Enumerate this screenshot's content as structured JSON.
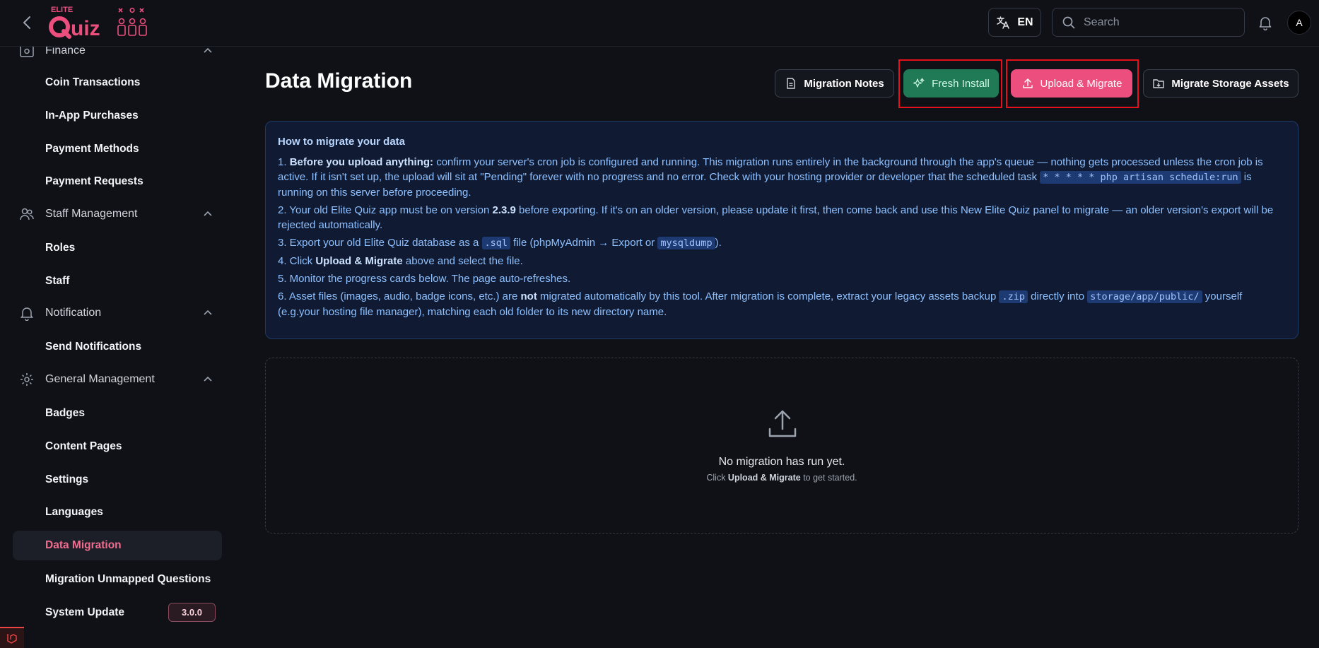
{
  "brand": {
    "logo_top": "ELITE",
    "logo_main": "Quiz",
    "accent": "#ec4f7d"
  },
  "topbar": {
    "language": "EN",
    "search_placeholder": "Search",
    "avatar_initial": "A"
  },
  "sidebar": {
    "groups": {
      "finance": "Finance",
      "staff": "Staff Management",
      "notification": "Notification",
      "general": "General Management"
    },
    "items": {
      "coin_transactions": "Coin Transactions",
      "in_app_purchases": "In-App Purchases",
      "payment_methods": "Payment Methods",
      "payment_requests": "Payment Requests",
      "roles": "Roles",
      "staff": "Staff",
      "send_notifications": "Send Notifications",
      "badges": "Badges",
      "content_pages": "Content Pages",
      "settings": "Settings",
      "languages": "Languages",
      "data_migration": "Data Migration",
      "migration_unmapped": "Migration Unmapped Questions",
      "system_update": "System Update"
    },
    "version_badge": "3.0.0"
  },
  "page": {
    "title": "Data Migration",
    "buttons": {
      "notes": "Migration Notes",
      "fresh": "Fresh Install",
      "upload": "Upload & Migrate",
      "storage": "Migrate Storage Assets"
    }
  },
  "info": {
    "heading": "How to migrate your data",
    "s1_num": "1.",
    "s1_bold": "Before you upload anything:",
    "s1_text": " confirm your server's cron job is configured and running. This migration runs entirely in the background through the app's queue — nothing gets processed unless the cron job is active. If it isn't set up, the upload will sit at \"Pending\" forever with no progress and no error. Check with your hosting provider or developer that the scheduled task ",
    "s1_code": "* * * * * php artisan schedule:run",
    "s1_tail": " is running on this server before proceeding.",
    "s2_a": "2. Your old Elite Quiz app must be on version ",
    "s2_bold": "2.3.9",
    "s2_b": " before exporting. If it's on an older version, please update it first, then come back and use this New Elite Quiz panel to migrate — an older version's export will be rejected automatically.",
    "s3_a": "3. Export your old Elite Quiz database as a ",
    "s3_code1": ".sql",
    "s3_b": " file (phpMyAdmin → Export or ",
    "s3_code2": "mysqldump",
    "s3_c": ").",
    "s4_a": "4. Click ",
    "s4_bold": "Upload & Migrate",
    "s4_b": " above and select the file.",
    "s5": "5. Monitor the progress cards below. The page auto-refreshes.",
    "s6_a": "6. Asset files (images, audio, badge icons, etc.) are ",
    "s6_bold": "not",
    "s6_b": " migrated automatically by this tool. After migration is complete, extract your legacy assets backup ",
    "s6_code1": ".zip",
    "s6_c": " directly into ",
    "s6_code2": "storage/app/public/",
    "s6_d": " yourself (e.g.your hosting file manager), matching each old folder to its new directory name."
  },
  "empty": {
    "title": "No migration has run yet.",
    "sub_a": "Click ",
    "sub_bold": "Upload & Migrate",
    "sub_b": " to get started."
  }
}
